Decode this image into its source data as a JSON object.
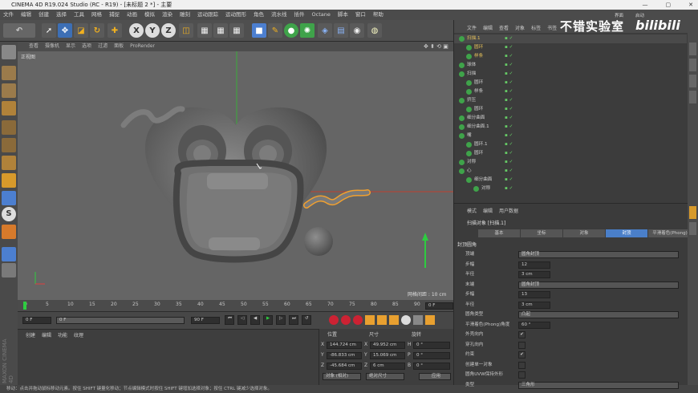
{
  "window": {
    "title": "CINEMA 4D R19.024 Studio (RC - R19) - [未标题 2 *] - 主要",
    "controls": [
      "—",
      "▢",
      "✕"
    ]
  },
  "menubar": [
    "文件",
    "编辑",
    "创建",
    "选择",
    "工具",
    "网格",
    "捕捉",
    "动画",
    "模拟",
    "渲染",
    "雕刻",
    "运动跟踪",
    "运动图形",
    "角色",
    "流水线",
    "插件",
    "Octane",
    "脚本",
    "窗口",
    "帮助"
  ],
  "right_header": {
    "interface_label": "界面",
    "interface_value": "启动"
  },
  "watermark": {
    "text": "不错实验室",
    "logo": "bilibili"
  },
  "view_menu": [
    "查看",
    "摄像机",
    "显示",
    "选项",
    "过滤",
    "面板",
    "ProRender"
  ],
  "viewport": {
    "label": "正视图",
    "grid_info": "网格间距 : 10 cm"
  },
  "timeline": {
    "ticks": [
      "0",
      "5",
      "10",
      "15",
      "20",
      "25",
      "30",
      "35",
      "40",
      "45",
      "50",
      "55",
      "60",
      "65",
      "70",
      "75",
      "80",
      "85",
      "90"
    ],
    "frame_display": "0 F"
  },
  "transport": {
    "start": "0 F",
    "current": "0 F",
    "end": "90 F",
    "max": "90 F"
  },
  "material_panel": {
    "menu": [
      "创建",
      "编辑",
      "功能",
      "纹理"
    ]
  },
  "coord_panel": {
    "headers": [
      "位置",
      "尺寸",
      "旋转"
    ],
    "rows": [
      {
        "axis": "X",
        "pos": "144.724 cm",
        "size_axis": "X",
        "size": "49.952 cm",
        "rot_axis": "H",
        "rot": "0 °"
      },
      {
        "axis": "Y",
        "pos": "-86.833 cm",
        "size_axis": "Y",
        "size": "15.069 cm",
        "rot_axis": "P",
        "rot": "0 °"
      },
      {
        "axis": "Z",
        "pos": "-45.684 cm",
        "size_axis": "Z",
        "size": "6 cm",
        "rot_axis": "B",
        "rot": "0 °"
      }
    ],
    "mode1": "对象 (相对)",
    "mode2": "绝对尺寸",
    "apply": "应用"
  },
  "status": "移动：点击并拖动鼠标移动元素。按住 SHIFT 键量化移动；节点编辑模式时按住 SHIFT 键增加选择对象；按住 CTRL 键减少选择对象。",
  "object_manager": {
    "menu": [
      "文件",
      "编辑",
      "查看",
      "对象",
      "标签",
      "书签"
    ],
    "objects": [
      {
        "name": "扫描.1",
        "indent": 0,
        "color": "#e6c15a",
        "icon": "sweep-icon"
      },
      {
        "name": "圆环",
        "indent": 1,
        "color": "#e6c15a",
        "icon": "circle-spline-icon"
      },
      {
        "name": "样条",
        "indent": 1,
        "color": "#e6c15a",
        "icon": "spline-icon"
      },
      {
        "name": "球体",
        "indent": 0,
        "color": "#cfcfcf",
        "icon": "sphere-icon"
      },
      {
        "name": "扫描",
        "indent": 0,
        "color": "#cfcfcf",
        "icon": "sweep-icon"
      },
      {
        "name": "圆环",
        "indent": 1,
        "color": "#cfcfcf",
        "icon": "circle-spline-icon"
      },
      {
        "name": "样条",
        "indent": 1,
        "color": "#cfcfcf",
        "icon": "spline-icon"
      },
      {
        "name": "挤压",
        "indent": 0,
        "color": "#cfcfcf",
        "icon": "extrude-icon"
      },
      {
        "name": "圆环",
        "indent": 1,
        "color": "#cfcfcf",
        "icon": "circle-spline-icon"
      },
      {
        "name": "细分曲面",
        "indent": 0,
        "color": "#cfcfcf",
        "icon": "subdivision-icon"
      },
      {
        "name": "细分曲面.1",
        "indent": 0,
        "color": "#cfcfcf",
        "icon": "subdivision-icon"
      },
      {
        "name": "嘴",
        "indent": 0,
        "color": "#cfcfcf",
        "icon": "null-icon"
      },
      {
        "name": "圆环.1",
        "indent": 1,
        "color": "#cfcfcf",
        "icon": "circle-spline-icon"
      },
      {
        "name": "圆环",
        "indent": 1,
        "color": "#cfcfcf",
        "icon": "circle-spline-icon"
      },
      {
        "name": "对称",
        "indent": 0,
        "color": "#cfcfcf",
        "icon": "symmetry-icon"
      },
      {
        "name": "心",
        "indent": 0,
        "color": "#cfcfcf",
        "icon": "null-icon"
      },
      {
        "name": "细分曲面",
        "indent": 1,
        "color": "#cfcfcf",
        "icon": "subdivision-icon"
      },
      {
        "name": "对称",
        "indent": 2,
        "color": "#cfcfcf",
        "icon": "symmetry-icon"
      }
    ]
  },
  "attribute_manager": {
    "menu": [
      "模式",
      "编辑",
      "用户数据"
    ],
    "object_title": "扫描对象 [扫描.1]",
    "tabs": [
      "基本",
      "坐标",
      "对象",
      "封顶",
      "平滑着色(Phong)"
    ],
    "active_tab": "封顶",
    "section": "封顶圆角",
    "rows": [
      {
        "label": "顶端",
        "value": "圆角封顶",
        "type": "dropdown"
      },
      {
        "label": "步幅",
        "value": "12",
        "type": "number"
      },
      {
        "label": "半径",
        "value": "3 cm",
        "type": "number"
      },
      {
        "label": "末端",
        "value": "圆角封顶",
        "type": "dropdown"
      },
      {
        "label": "步幅",
        "value": "13",
        "type": "number"
      },
      {
        "label": "半径",
        "value": "3 cm",
        "type": "number"
      },
      {
        "label": "圆角类型",
        "value": "凸起",
        "type": "dropdown"
      },
      {
        "label": "平滑着色(Phong)角度",
        "value": "60 °",
        "type": "number"
      },
      {
        "label": "外壳向内",
        "value": "✔",
        "type": "check"
      },
      {
        "label": "穿孔向内",
        "value": "",
        "type": "check"
      },
      {
        "label": "约束",
        "value": "✔",
        "type": "check"
      },
      {
        "label": "创建单一对象",
        "value": "",
        "type": "check"
      },
      {
        "label": "圆角UVW保持外形",
        "value": "",
        "type": "check"
      },
      {
        "label": "类型",
        "value": "三角形",
        "type": "dropdown"
      }
    ]
  }
}
